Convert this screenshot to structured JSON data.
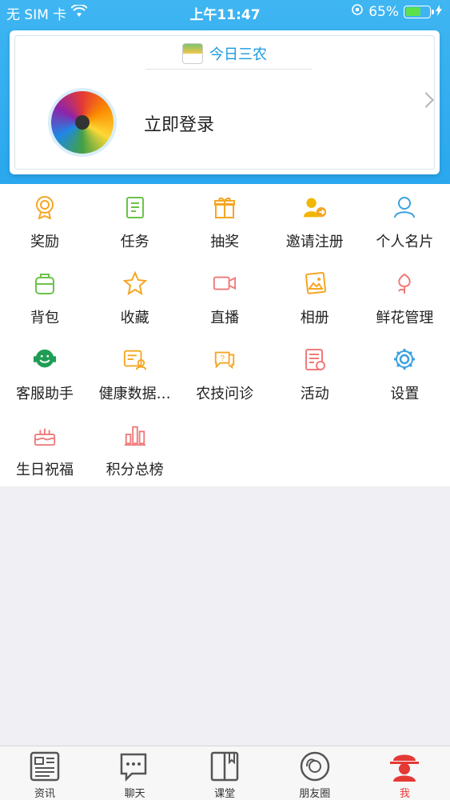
{
  "status_bar": {
    "carrier": "无 SIM 卡",
    "time": "上午11:47",
    "battery": "65%",
    "battery_level": 0.65
  },
  "header": {
    "brand": "今日三农",
    "login_text": "立即登录"
  },
  "grid": {
    "items": [
      {
        "label": "奖励",
        "icon": "award-icon",
        "color": "#f5a623"
      },
      {
        "label": "任务",
        "icon": "task-icon",
        "color": "#6cc24a"
      },
      {
        "label": "抽奖",
        "icon": "gift-icon",
        "color": "#f5a623"
      },
      {
        "label": "邀请注册",
        "icon": "invite-user-icon",
        "color": "#f2b705"
      },
      {
        "label": "个人名片",
        "icon": "profile-card-icon",
        "color": "#3ba1e0"
      },
      {
        "label": "背包",
        "icon": "backpack-icon",
        "color": "#6cc24a"
      },
      {
        "label": "收藏",
        "icon": "star-icon",
        "color": "#f5a623"
      },
      {
        "label": "直播",
        "icon": "video-camera-icon",
        "color": "#f07a7a"
      },
      {
        "label": "相册",
        "icon": "photo-album-icon",
        "color": "#f5a623"
      },
      {
        "label": "鲜花管理",
        "icon": "flower-icon",
        "color": "#f07a7a"
      },
      {
        "label": "客服助手",
        "icon": "customer-service-icon",
        "color": "#1f9d55"
      },
      {
        "label": "健康数据…",
        "icon": "health-data-icon",
        "color": "#f5a623"
      },
      {
        "label": "农技问诊",
        "icon": "consult-icon",
        "color": "#f5a623"
      },
      {
        "label": "活动",
        "icon": "activity-icon",
        "color": "#f07a7a"
      },
      {
        "label": "设置",
        "icon": "gear-icon",
        "color": "#3ba1e0"
      },
      {
        "label": "生日祝福",
        "icon": "birthday-cake-icon",
        "color": "#f07a7a"
      },
      {
        "label": "积分总榜",
        "icon": "leaderboard-icon",
        "color": "#f07a7a"
      }
    ]
  },
  "tabbar": {
    "tabs": [
      {
        "label": "资讯",
        "icon": "news-icon"
      },
      {
        "label": "聊天",
        "icon": "chat-icon"
      },
      {
        "label": "课堂",
        "icon": "book-icon"
      },
      {
        "label": "朋友圈",
        "icon": "moments-icon"
      },
      {
        "label": "我",
        "icon": "me-icon",
        "active": true
      }
    ]
  },
  "colors": {
    "accent": "#2aa7ee",
    "active_tab": "#e53935"
  }
}
